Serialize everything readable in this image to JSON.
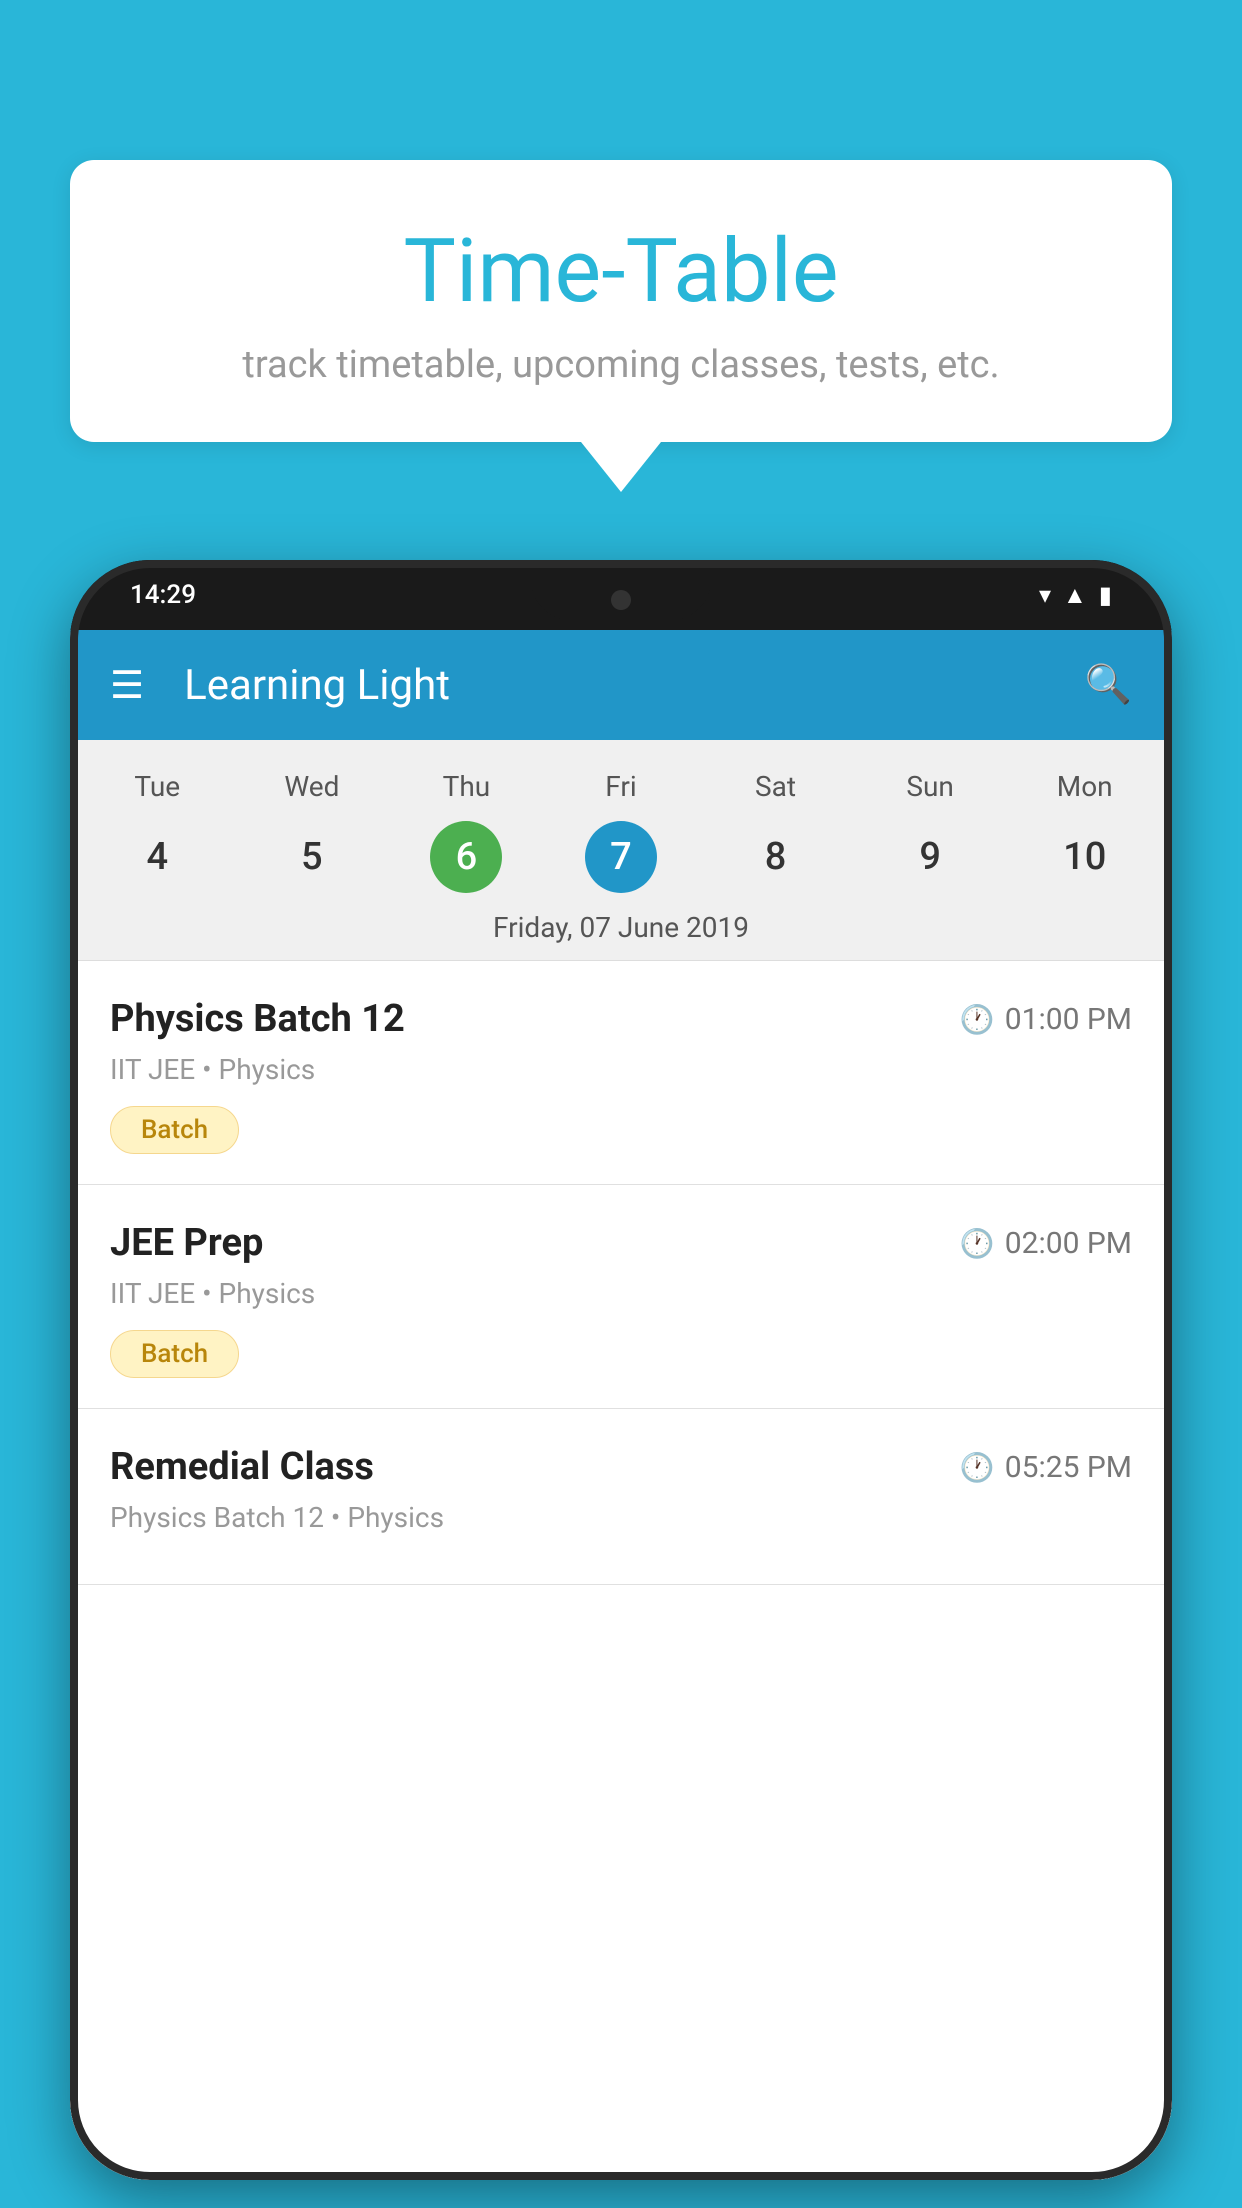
{
  "background_color": "#29B6D8",
  "speech_bubble": {
    "title": "Time-Table",
    "subtitle": "track timetable, upcoming classes, tests, etc."
  },
  "phone": {
    "status_bar": {
      "time": "14:29"
    },
    "app_bar": {
      "title": "Learning Light"
    },
    "calendar": {
      "days": [
        "Tue",
        "Wed",
        "Thu",
        "Fri",
        "Sat",
        "Sun",
        "Mon"
      ],
      "dates": [
        "4",
        "5",
        "6",
        "7",
        "8",
        "9",
        "10"
      ],
      "today_index": 2,
      "selected_index": 3,
      "selected_label": "Friday, 07 June 2019"
    },
    "schedule": [
      {
        "title": "Physics Batch 12",
        "time": "01:00 PM",
        "subtitle": "IIT JEE • Physics",
        "badge": "Batch"
      },
      {
        "title": "JEE Prep",
        "time": "02:00 PM",
        "subtitle": "IIT JEE • Physics",
        "badge": "Batch"
      },
      {
        "title": "Remedial Class",
        "time": "05:25 PM",
        "subtitle": "Physics Batch 12 • Physics",
        "badge": ""
      }
    ]
  }
}
